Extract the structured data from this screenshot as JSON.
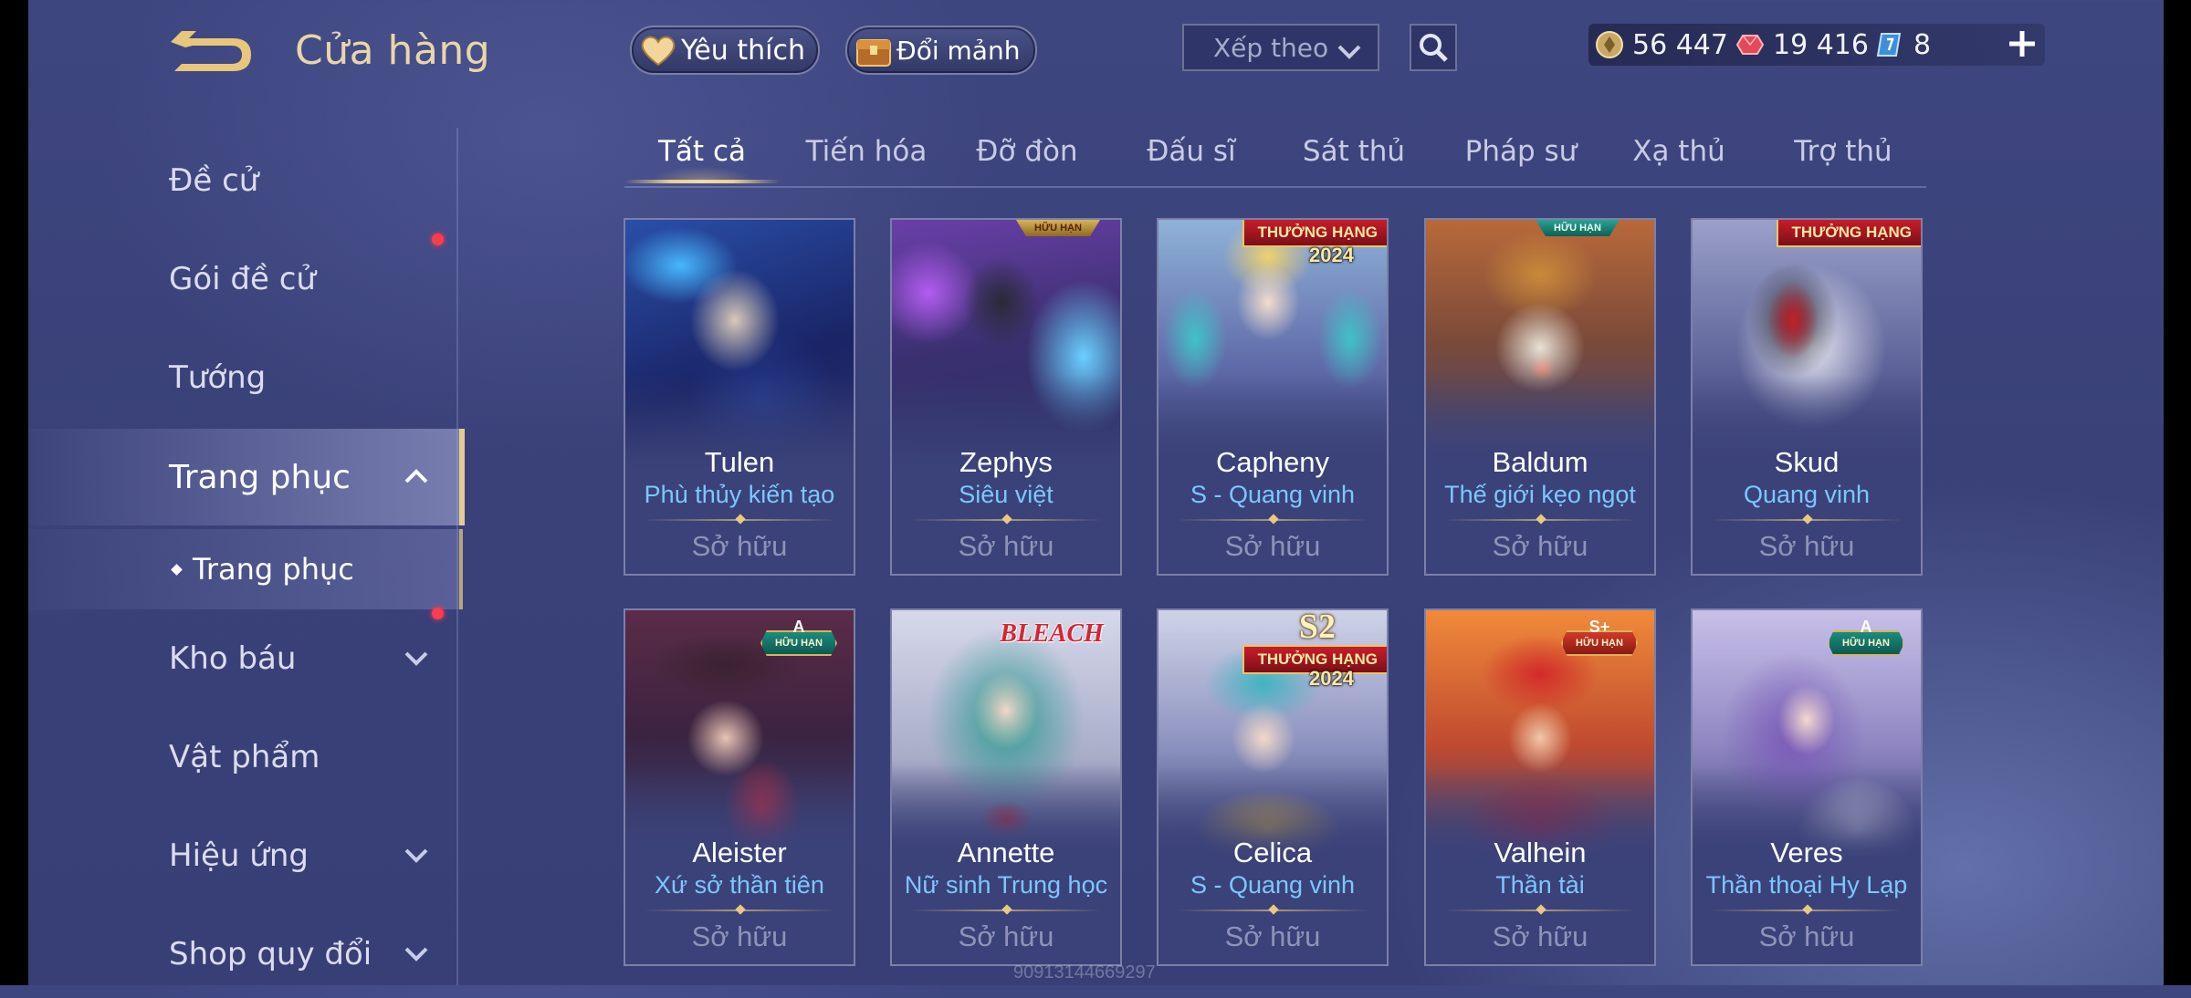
{
  "header": {
    "title": "Cửa hàng",
    "favorite_label": "Yêu thích",
    "shard_label": "Đổi mảnh",
    "sort_placeholder": "Xếp theo"
  },
  "currencies": {
    "gold": "56 447",
    "ruby": "19 416",
    "voucher": "8"
  },
  "sidebar": {
    "items": [
      {
        "label": "Đề cử"
      },
      {
        "label": "Gói đề cử"
      },
      {
        "label": "Tướng"
      },
      {
        "label": "Trang phục"
      },
      {
        "label": "Trang phục"
      },
      {
        "label": "Kho báu"
      },
      {
        "label": "Vật phẩm"
      },
      {
        "label": "Hiệu ứng"
      },
      {
        "label": "Shop quy đổi"
      }
    ]
  },
  "tabs": [
    "Tất cả",
    "Tiến hóa",
    "Đỡ đòn",
    "Đấu sĩ",
    "Sát thủ",
    "Pháp sư",
    "Xạ thủ",
    "Trợ thủ"
  ],
  "cards": [
    {
      "hero": "Tulen",
      "skin": "Phù thủy kiến tạo",
      "status": "Sở hữu"
    },
    {
      "hero": "Zephys",
      "skin": "Siêu việt",
      "status": "Sở hữu",
      "badge_text": "HỮU HẠN"
    },
    {
      "hero": "Capheny",
      "skin": "S - Quang vinh",
      "status": "Sở hữu",
      "badge_text": "THƯỞNG HẠNG",
      "badge_year": "2024"
    },
    {
      "hero": "Baldum",
      "skin": "Thế giới kẹo ngọt",
      "status": "Sở hữu",
      "badge_text": "HỮU HẠN"
    },
    {
      "hero": "Skud",
      "skin": "Quang vinh",
      "status": "Sở hữu",
      "badge_text": "THƯỞNG HẠNG"
    },
    {
      "hero": "Aleister",
      "skin": "Xứ sở thần tiên",
      "status": "Sở hữu",
      "badge_grade": "A",
      "badge_text": "HỮU HẠN"
    },
    {
      "hero": "Annette",
      "skin": "Nữ sinh Trung học",
      "status": "Sở hữu",
      "badge_text": "BLEACH"
    },
    {
      "hero": "Celica",
      "skin": "S - Quang vinh",
      "status": "Sở hữu",
      "badge_season": "S2",
      "badge_text": "THƯỞNG HẠNG",
      "badge_year": "2024"
    },
    {
      "hero": "Valhein",
      "skin": "Thần tài",
      "status": "Sở hữu",
      "badge_grade": "S+",
      "badge_text": "HỮU HẠN"
    },
    {
      "hero": "Veres",
      "skin": "Thần thoại Hy Lạp",
      "status": "Sở hữu",
      "badge_grade": "A",
      "badge_text": "HỮU HẠN"
    }
  ],
  "watermark": "909131446692​97",
  "icons": {
    "back": "back-arrow-icon",
    "favorite": "heart-icon",
    "shard": "shard-chest-icon",
    "sort": "chevron-down-icon",
    "search": "search-icon",
    "gold": "gold-coin-icon",
    "ruby": "ruby-icon",
    "voucher": "voucher-icon",
    "add": "plus-icon"
  },
  "colors": {
    "accent_gold": "#e8d6a8",
    "skin_name": "#7cc7ff",
    "notification": "#ff3b4e"
  }
}
